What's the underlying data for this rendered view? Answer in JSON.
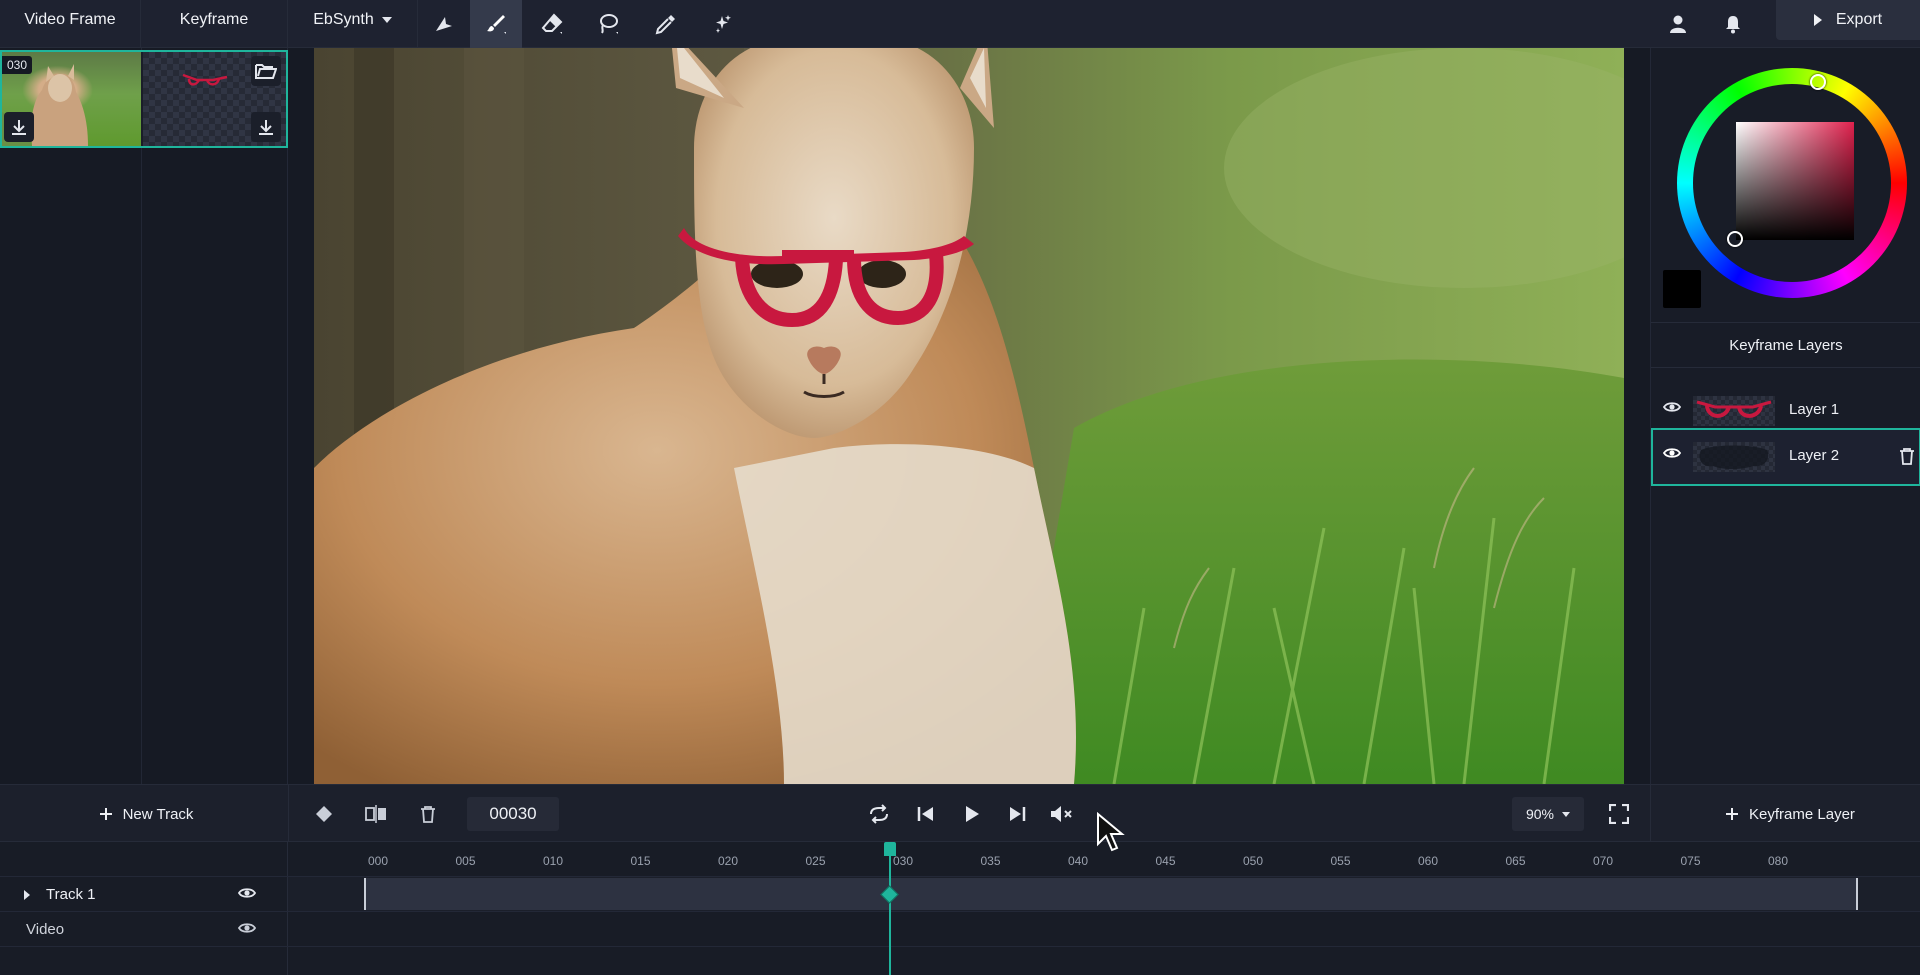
{
  "topbar": {
    "tabs": [
      {
        "label": "Video Frame"
      },
      {
        "label": "Keyframe"
      },
      {
        "label": "EbSynth"
      }
    ],
    "tools": [
      "select-arrow-icon",
      "brush-icon",
      "eraser-icon",
      "lasso-icon",
      "eyedropper-icon",
      "magic-sparkle-icon"
    ],
    "active_tool": "brush-icon",
    "export_label": "Export"
  },
  "thumbnail": {
    "frame_number": "030"
  },
  "colors": {
    "accent": "#1fb59c",
    "brush_color": "#000000",
    "hue": "#e0214d"
  },
  "layers": {
    "title": "Keyframe Layers",
    "items": [
      {
        "name": "Layer 1",
        "selected": false
      },
      {
        "name": "Layer 2",
        "selected": true
      }
    ]
  },
  "controls": {
    "new_track_label": "New Track",
    "frame_value": "00030",
    "zoom_value": "90%",
    "keyframe_layer_label": "Keyframe Layer"
  },
  "timeline": {
    "ticks": [
      "000",
      "005",
      "010",
      "015",
      "020",
      "025",
      "030",
      "035",
      "040",
      "045",
      "050",
      "055",
      "060",
      "065",
      "070",
      "075",
      "080"
    ],
    "playhead_frame": 30,
    "tracks": [
      {
        "name": "Track 1"
      },
      {
        "name": "Video"
      }
    ]
  }
}
